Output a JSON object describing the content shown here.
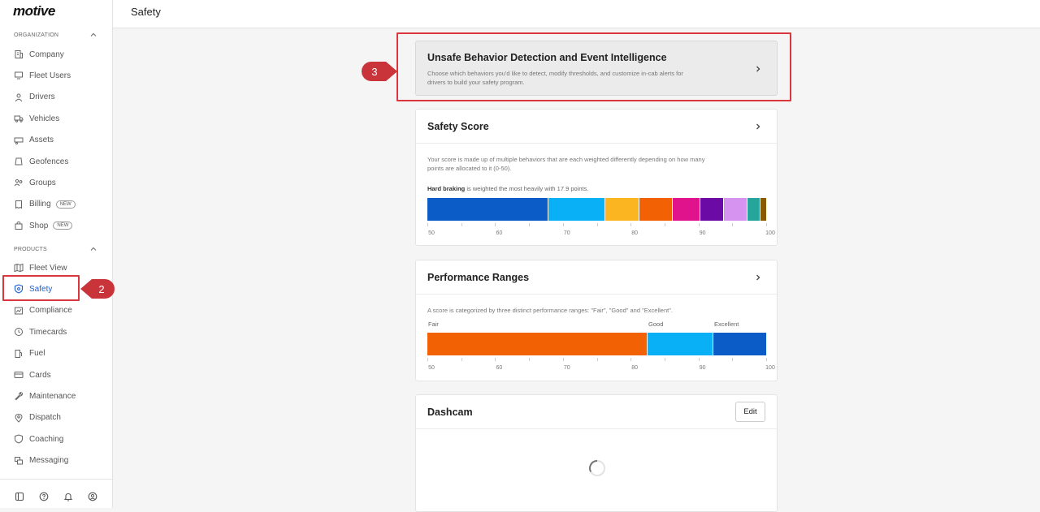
{
  "app": {
    "logo": "motive"
  },
  "sidebar": {
    "org_label": "ORGANIZATION",
    "products_label": "PRODUCTS",
    "org_items": [
      {
        "label": "Company",
        "icon": "building-icon"
      },
      {
        "label": "Fleet Users",
        "icon": "monitor-icon"
      },
      {
        "label": "Drivers",
        "icon": "person-icon"
      },
      {
        "label": "Vehicles",
        "icon": "truck-icon"
      },
      {
        "label": "Assets",
        "icon": "trailer-icon"
      },
      {
        "label": "Geofences",
        "icon": "geofence-icon"
      },
      {
        "label": "Groups",
        "icon": "group-icon"
      },
      {
        "label": "Billing",
        "icon": "receipt-icon",
        "badge": "NEW"
      },
      {
        "label": "Shop",
        "icon": "bag-icon",
        "badge": "NEW"
      }
    ],
    "product_items": [
      {
        "label": "Fleet View",
        "icon": "map-icon"
      },
      {
        "label": "Safety",
        "icon": "shield-icon",
        "active": true
      },
      {
        "label": "Compliance",
        "icon": "chart-icon"
      },
      {
        "label": "Timecards",
        "icon": "clock-icon"
      },
      {
        "label": "Fuel",
        "icon": "fuel-icon"
      },
      {
        "label": "Cards",
        "icon": "card-icon"
      },
      {
        "label": "Maintenance",
        "icon": "wrench-icon"
      },
      {
        "label": "Dispatch",
        "icon": "pin-icon"
      },
      {
        "label": "Coaching",
        "icon": "coach-shield-icon"
      },
      {
        "label": "Messaging",
        "icon": "chat-icon"
      }
    ],
    "bottom_icons": [
      "book-icon",
      "help-icon",
      "bell-icon",
      "user-icon"
    ]
  },
  "header": {
    "title": "Safety"
  },
  "unsafe_card": {
    "title": "Unsafe Behavior Detection and Event Intelligence",
    "desc1": "Choose which behaviors you'd like to detect, modify thresholds, and customize in-cab alerts for",
    "desc2": "drivers to build your safety program."
  },
  "safety_score": {
    "title": "Safety Score",
    "desc1": "Your score is made up of multiple behaviors that are each weighted differently depending on how many",
    "desc2": "points are allocated to it (0-50).",
    "highlight_bold": "Hard braking",
    "highlight_rest": " is weighted the most heavily with 17.9 points.",
    "segments": [
      {
        "weight": 17.9,
        "color": "#0b5cc7"
      },
      {
        "weight": 8.5,
        "color": "#0ab0f5"
      },
      {
        "weight": 5.0,
        "color": "#fbb520"
      },
      {
        "weight": 4.9,
        "color": "#f36105"
      },
      {
        "weight": 4.2,
        "color": "#e1138c"
      },
      {
        "weight": 3.5,
        "color": "#6c0aa6"
      },
      {
        "weight": 3.4,
        "color": "#d694f0"
      },
      {
        "weight": 2.0,
        "color": "#26a69a"
      },
      {
        "weight": 0.8,
        "color": "#8a5a00"
      }
    ],
    "scale_labels": [
      "50",
      "60",
      "70",
      "80",
      "90",
      "100"
    ]
  },
  "performance": {
    "title": "Performance Ranges",
    "desc": "A score is categorized by three distinct performance ranges: \"Fair\", \"Good\" and \"Excellent\".",
    "ranges": [
      {
        "label": "Fair",
        "from": 50,
        "to": 82.5,
        "color": "#f36105"
      },
      {
        "label": "Good",
        "from": 82.5,
        "to": 92.2,
        "color": "#0ab0f5"
      },
      {
        "label": "Excellent",
        "from": 92.2,
        "to": 100,
        "color": "#0b5cc7"
      }
    ],
    "scale_labels": [
      "50",
      "60",
      "70",
      "80",
      "90",
      "100"
    ]
  },
  "dashcam": {
    "title": "Dashcam",
    "edit_label": "Edit"
  },
  "annotations": {
    "marker2": "2",
    "marker3": "3"
  }
}
